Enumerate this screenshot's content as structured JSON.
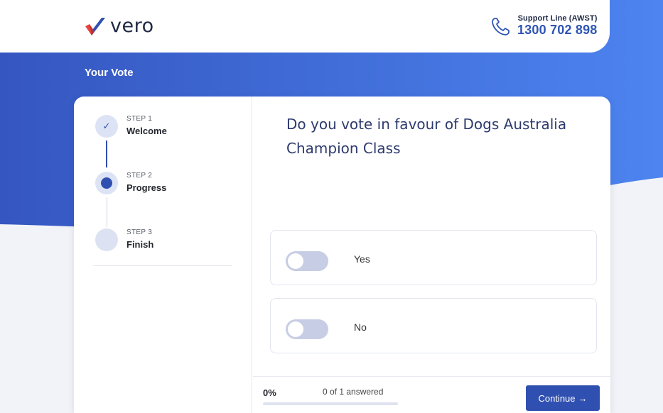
{
  "header": {
    "logo_text": "vero",
    "support_label": "Support Line (AWST)",
    "support_number": "1300 702 898"
  },
  "page_title": "Your Vote",
  "steps": [
    {
      "number": "STEP 1",
      "name": "Welcome",
      "state": "done"
    },
    {
      "number": "STEP 2",
      "name": "Progress",
      "state": "active"
    },
    {
      "number": "STEP 3",
      "name": "Finish",
      "state": "todo"
    }
  ],
  "question": "Do you vote in favour of Dogs Australia Champion Class",
  "options": [
    {
      "label": "Yes",
      "selected": false
    },
    {
      "label": "No",
      "selected": false
    }
  ],
  "footer": {
    "progress_percent": "0%",
    "progress_fraction": 0,
    "answered_text": "0 of 1 answered",
    "continue_label": "Continue",
    "continue_arrow": "→"
  },
  "colors": {
    "brand_blue": "#2f50b0",
    "backdrop_blue": "#3b5fc8",
    "logo_red": "#e8413c",
    "question_text": "#2d3a6e"
  },
  "icons": {
    "logo": "check-mark-logo",
    "support": "phone-icon",
    "step_done": "checkmark-icon"
  }
}
